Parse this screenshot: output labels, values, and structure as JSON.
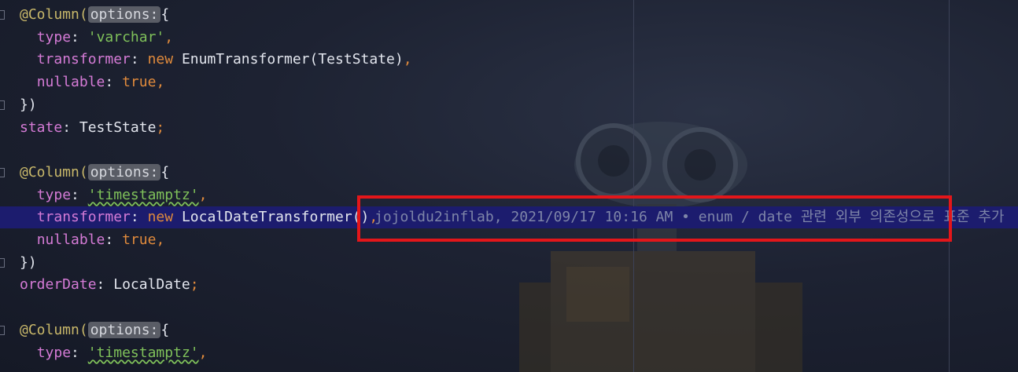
{
  "editor": {
    "lines": [
      {
        "type": "annotation_open",
        "anno": "@Column(",
        "hint": "options:",
        "tail": "{"
      },
      {
        "type": "prop_str",
        "key": "type",
        "value": "'varchar'",
        "squiggle": false
      },
      {
        "type": "prop_new",
        "key": "transformer",
        "kw": "new",
        "call": "EnumTransformer(TestState)"
      },
      {
        "type": "prop_kw",
        "key": "nullable",
        "value": "true"
      },
      {
        "type": "close",
        "text": "})"
      },
      {
        "type": "field",
        "name": "state",
        "typeName": "TestState"
      },
      {
        "type": "blank"
      },
      {
        "type": "annotation_open",
        "anno": "@Column(",
        "hint": "options:",
        "tail": "{"
      },
      {
        "type": "prop_str",
        "key": "type",
        "value": "'timestamptz'",
        "squiggle": true
      },
      {
        "type": "prop_new",
        "key": "transformer",
        "kw": "new",
        "call": "LocalDateTransformer()",
        "current": true
      },
      {
        "type": "prop_kw",
        "key": "nullable",
        "value": "true"
      },
      {
        "type": "close",
        "text": "})"
      },
      {
        "type": "field",
        "name": "orderDate",
        "typeName": "LocalDate"
      },
      {
        "type": "blank"
      },
      {
        "type": "annotation_open",
        "anno": "@Column(",
        "hint": "options:",
        "tail": "{"
      },
      {
        "type": "prop_str",
        "key": "type",
        "value": "'timestamptz'",
        "squiggle": true
      }
    ],
    "blame": "jojoldu2inflab, 2021/09/17 10:16 AM • enum / date 관련 외부 의존성으로 표준 추가",
    "colors": {
      "current_line": "#1c1c6e",
      "highlight_box": "#e3161a"
    }
  }
}
